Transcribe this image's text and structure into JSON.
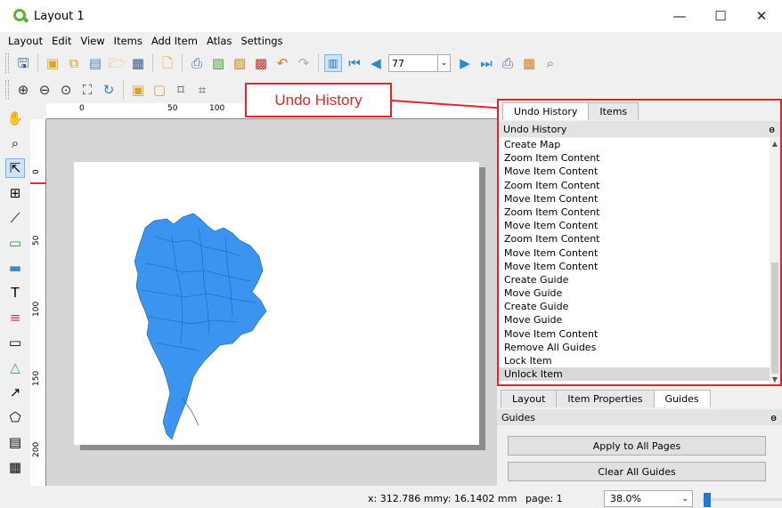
{
  "window": {
    "title": "Layout 1",
    "controls": {
      "minimize": "—",
      "maximize": "☐",
      "close": "✕"
    }
  },
  "menu": [
    "Layout",
    "Edit",
    "View",
    "Items",
    "Add Item",
    "Atlas",
    "Settings"
  ],
  "toolbar": {
    "page_number": "77",
    "icons_row1": [
      "save-icon",
      "new-layout-icon",
      "duplicate-layout-icon",
      "layout-manager-icon",
      "open-folder-icon",
      "save-template-icon",
      "new-page-icon",
      "print-icon",
      "export-image-icon",
      "export-svg-icon",
      "export-pdf-icon",
      "undo-icon",
      "redo-icon",
      "atlas-preview-icon",
      "first-feature-icon",
      "previous-feature-icon",
      "next-feature-icon",
      "last-feature-icon",
      "atlas-print-icon",
      "atlas-export-icon",
      "atlas-settings-icon"
    ],
    "icons_row2": [
      "zoom-in-icon",
      "zoom-out-icon",
      "zoom-actual-icon",
      "zoom-full-icon",
      "refresh-icon",
      "group-icon",
      "ungroup-icon",
      "lock-icon",
      "unlock-icon"
    ]
  },
  "left_tools": [
    "pan-icon",
    "zoom-icon",
    "select-icon",
    "move-content-icon",
    "edit-nodes-icon",
    "add-map-icon",
    "add-picture-icon",
    "add-label-icon",
    "add-legend-icon",
    "add-scalebar-icon",
    "add-shape-icon",
    "add-arrow-icon",
    "add-polygon-icon",
    "add-html-icon",
    "add-table-icon"
  ],
  "rulers": {
    "h_labels": [
      "0",
      "50",
      "100"
    ],
    "v_labels": [
      "0",
      "50",
      "100",
      "150",
      "200"
    ]
  },
  "callout": {
    "text": "Undo History"
  },
  "undo_dock": {
    "tabs": [
      "Undo History",
      "Items"
    ],
    "header": "Undo History",
    "float_icon": "ɵ",
    "entries": [
      "Create Map",
      "Zoom Item Content",
      "Move Item Content",
      "Zoom Item Content",
      "Move Item Content",
      "Zoom Item Content",
      "Move Item Content",
      "Zoom Item Content",
      "Move Item Content",
      "Move Item Content",
      "Create Guide",
      "Move Guide",
      "Create Guide",
      "Move Guide",
      "Move Item Content",
      "Remove All Guides",
      "Lock Item",
      "Unlock Item"
    ],
    "selected_index": 17
  },
  "guides_dock": {
    "tabs": [
      "Layout",
      "Item Properties",
      "Guides"
    ],
    "active_tab": "Guides",
    "header": "Guides",
    "apply_button": "Apply to All Pages",
    "clear_button": "Clear All Guides"
  },
  "status": {
    "x": "x: 312.786 mm",
    "y": "y: 16.1402 mm",
    "page": "page: 1",
    "zoom": "38.0%"
  },
  "colors": {
    "accent_red": "#e0262b",
    "map_fill": "#3b95f0",
    "selection_blue": "#1f78d1"
  }
}
